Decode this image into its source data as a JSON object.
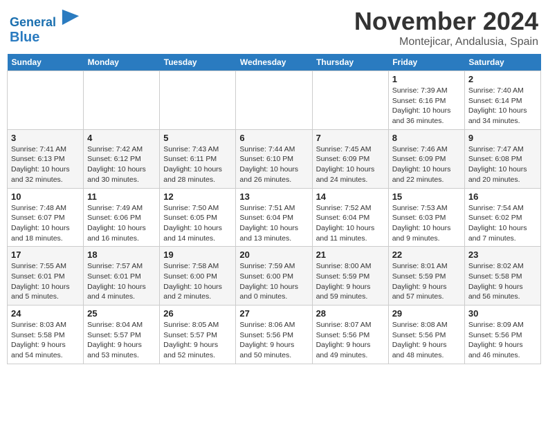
{
  "header": {
    "logo_line1": "General",
    "logo_line2": "Blue",
    "month": "November 2024",
    "location": "Montejicar, Andalusia, Spain"
  },
  "weekdays": [
    "Sunday",
    "Monday",
    "Tuesday",
    "Wednesday",
    "Thursday",
    "Friday",
    "Saturday"
  ],
  "weeks": [
    [
      {
        "day": "",
        "info": ""
      },
      {
        "day": "",
        "info": ""
      },
      {
        "day": "",
        "info": ""
      },
      {
        "day": "",
        "info": ""
      },
      {
        "day": "",
        "info": ""
      },
      {
        "day": "1",
        "info": "Sunrise: 7:39 AM\nSunset: 6:16 PM\nDaylight: 10 hours\nand 36 minutes."
      },
      {
        "day": "2",
        "info": "Sunrise: 7:40 AM\nSunset: 6:14 PM\nDaylight: 10 hours\nand 34 minutes."
      }
    ],
    [
      {
        "day": "3",
        "info": "Sunrise: 7:41 AM\nSunset: 6:13 PM\nDaylight: 10 hours\nand 32 minutes."
      },
      {
        "day": "4",
        "info": "Sunrise: 7:42 AM\nSunset: 6:12 PM\nDaylight: 10 hours\nand 30 minutes."
      },
      {
        "day": "5",
        "info": "Sunrise: 7:43 AM\nSunset: 6:11 PM\nDaylight: 10 hours\nand 28 minutes."
      },
      {
        "day": "6",
        "info": "Sunrise: 7:44 AM\nSunset: 6:10 PM\nDaylight: 10 hours\nand 26 minutes."
      },
      {
        "day": "7",
        "info": "Sunrise: 7:45 AM\nSunset: 6:09 PM\nDaylight: 10 hours\nand 24 minutes."
      },
      {
        "day": "8",
        "info": "Sunrise: 7:46 AM\nSunset: 6:09 PM\nDaylight: 10 hours\nand 22 minutes."
      },
      {
        "day": "9",
        "info": "Sunrise: 7:47 AM\nSunset: 6:08 PM\nDaylight: 10 hours\nand 20 minutes."
      }
    ],
    [
      {
        "day": "10",
        "info": "Sunrise: 7:48 AM\nSunset: 6:07 PM\nDaylight: 10 hours\nand 18 minutes."
      },
      {
        "day": "11",
        "info": "Sunrise: 7:49 AM\nSunset: 6:06 PM\nDaylight: 10 hours\nand 16 minutes."
      },
      {
        "day": "12",
        "info": "Sunrise: 7:50 AM\nSunset: 6:05 PM\nDaylight: 10 hours\nand 14 minutes."
      },
      {
        "day": "13",
        "info": "Sunrise: 7:51 AM\nSunset: 6:04 PM\nDaylight: 10 hours\nand 13 minutes."
      },
      {
        "day": "14",
        "info": "Sunrise: 7:52 AM\nSunset: 6:04 PM\nDaylight: 10 hours\nand 11 minutes."
      },
      {
        "day": "15",
        "info": "Sunrise: 7:53 AM\nSunset: 6:03 PM\nDaylight: 10 hours\nand 9 minutes."
      },
      {
        "day": "16",
        "info": "Sunrise: 7:54 AM\nSunset: 6:02 PM\nDaylight: 10 hours\nand 7 minutes."
      }
    ],
    [
      {
        "day": "17",
        "info": "Sunrise: 7:55 AM\nSunset: 6:01 PM\nDaylight: 10 hours\nand 5 minutes."
      },
      {
        "day": "18",
        "info": "Sunrise: 7:57 AM\nSunset: 6:01 PM\nDaylight: 10 hours\nand 4 minutes."
      },
      {
        "day": "19",
        "info": "Sunrise: 7:58 AM\nSunset: 6:00 PM\nDaylight: 10 hours\nand 2 minutes."
      },
      {
        "day": "20",
        "info": "Sunrise: 7:59 AM\nSunset: 6:00 PM\nDaylight: 10 hours\nand 0 minutes."
      },
      {
        "day": "21",
        "info": "Sunrise: 8:00 AM\nSunset: 5:59 PM\nDaylight: 9 hours\nand 59 minutes."
      },
      {
        "day": "22",
        "info": "Sunrise: 8:01 AM\nSunset: 5:59 PM\nDaylight: 9 hours\nand 57 minutes."
      },
      {
        "day": "23",
        "info": "Sunrise: 8:02 AM\nSunset: 5:58 PM\nDaylight: 9 hours\nand 56 minutes."
      }
    ],
    [
      {
        "day": "24",
        "info": "Sunrise: 8:03 AM\nSunset: 5:58 PM\nDaylight: 9 hours\nand 54 minutes."
      },
      {
        "day": "25",
        "info": "Sunrise: 8:04 AM\nSunset: 5:57 PM\nDaylight: 9 hours\nand 53 minutes."
      },
      {
        "day": "26",
        "info": "Sunrise: 8:05 AM\nSunset: 5:57 PM\nDaylight: 9 hours\nand 52 minutes."
      },
      {
        "day": "27",
        "info": "Sunrise: 8:06 AM\nSunset: 5:56 PM\nDaylight: 9 hours\nand 50 minutes."
      },
      {
        "day": "28",
        "info": "Sunrise: 8:07 AM\nSunset: 5:56 PM\nDaylight: 9 hours\nand 49 minutes."
      },
      {
        "day": "29",
        "info": "Sunrise: 8:08 AM\nSunset: 5:56 PM\nDaylight: 9 hours\nand 48 minutes."
      },
      {
        "day": "30",
        "info": "Sunrise: 8:09 AM\nSunset: 5:56 PM\nDaylight: 9 hours\nand 46 minutes."
      }
    ]
  ]
}
